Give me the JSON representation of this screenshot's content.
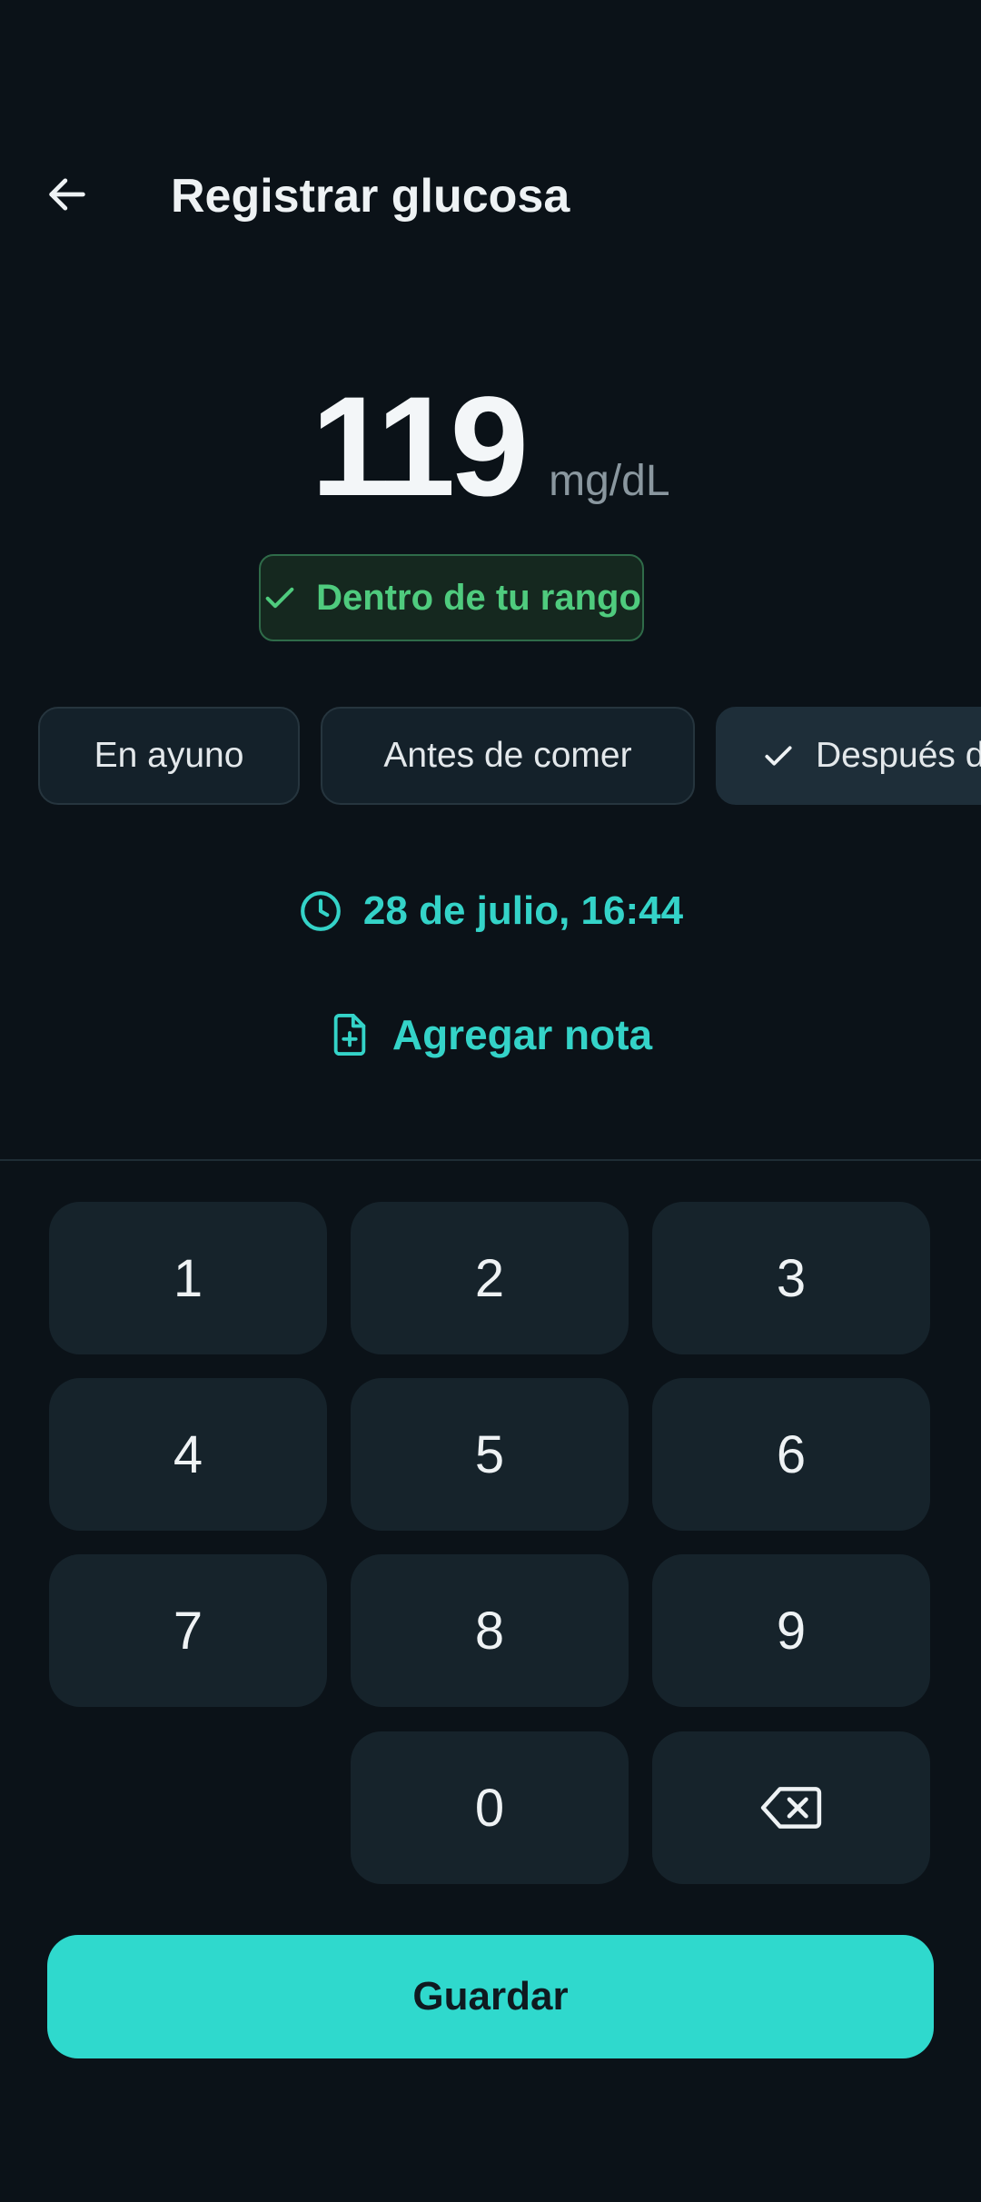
{
  "header": {
    "back_icon": "arrow-left-icon",
    "title": "Registrar glucosa"
  },
  "reading": {
    "value": "119",
    "unit": "mg/dL",
    "status": "Dentro de tu rango",
    "status_icon": "check-icon",
    "status_color": "#4fcb7e"
  },
  "meal_context": {
    "options": [
      {
        "label": "En ayuno",
        "selected": false
      },
      {
        "label": "Antes de comer",
        "selected": false
      },
      {
        "label": "Después de comer",
        "selected": true
      }
    ]
  },
  "datetime": {
    "icon": "clock-icon",
    "label": "28 de julio, 16:44"
  },
  "note": {
    "icon": "note-add-icon",
    "label": "Agregar nota"
  },
  "keypad": {
    "keys": [
      "1",
      "2",
      "3",
      "4",
      "5",
      "6",
      "7",
      "8",
      "9",
      "0"
    ],
    "backspace_icon": "backspace-icon"
  },
  "actions": {
    "save_label": "Guardar"
  },
  "colors": {
    "background": "#0b1218",
    "accent": "#2fd9cd",
    "in_range": "#4fcb7e"
  }
}
